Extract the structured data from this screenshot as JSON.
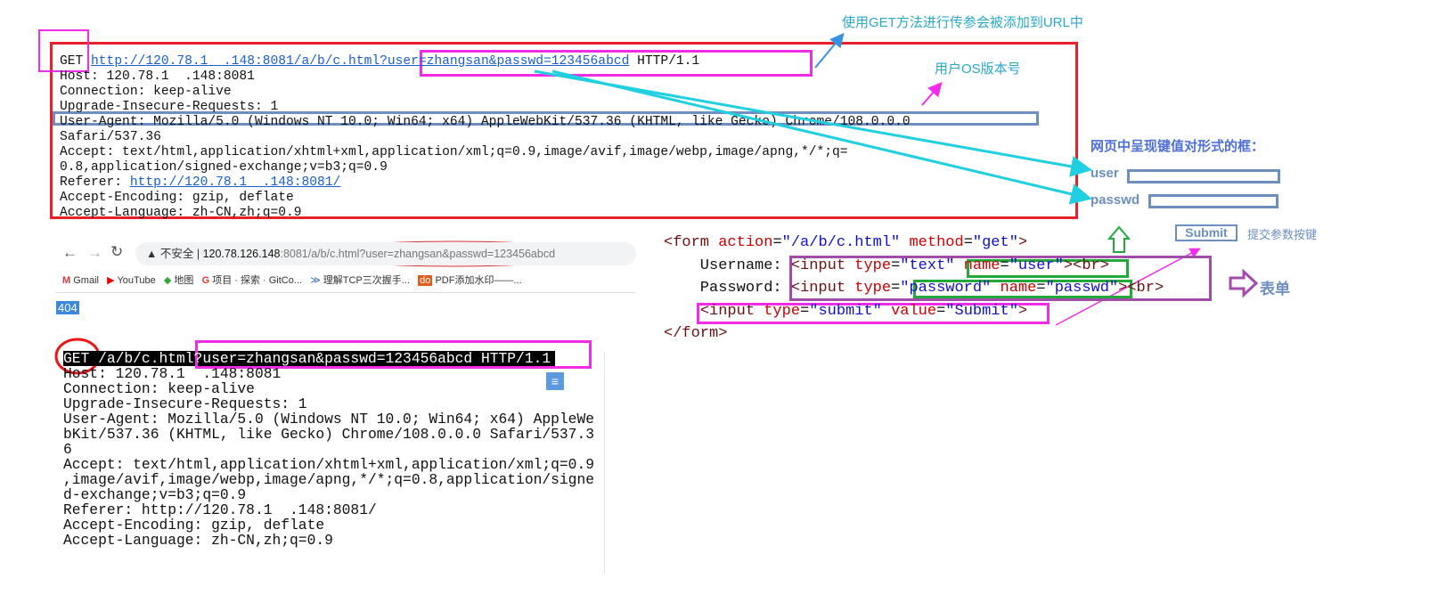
{
  "top_request": {
    "method": "GET",
    "url": "http://120.78.1  .148:8081/a/b/c.html",
    "query": "?user=zhangsan&passwd=123456abcd",
    "protocol": " HTTP/1.1",
    "lines": [
      "Host: 120.78.1  .148:8081",
      "Connection: keep-alive",
      "Upgrade-Insecure-Requests: 1",
      "User-Agent: Mozilla/5.0 (Windows NT 10.0; Win64; x64) AppleWebKit/537.36 (KHTML, like Gecko) Chrome/108.0.0.0",
      "Safari/537.36",
      "Accept: text/html,application/xhtml+xml,application/xml;q=0.9,image/avif,image/webp,image/apng,*/*;q=",
      "0.8,application/signed-exchange;v=b3;q=0.9"
    ],
    "referer_label": "Referer: ",
    "referer_url": "http://120.78.1  .148:8081/",
    "tail_lines": [
      "Accept-Encoding: gzip, deflate",
      "Accept-Language: zh-CN,zh;q=0.9"
    ]
  },
  "annotations": {
    "get_url": "使用GET方法进行传参会被添加到URL中",
    "os_version": "用户OS版本号",
    "kv_title": "网页中呈现键值对形式的框：",
    "user_label": "user",
    "passwd_label": "passwd",
    "submit_label": "Submit",
    "submit_note": "提交参数按键",
    "form_label": "表单"
  },
  "browser": {
    "insecure": "不安全",
    "host": "120.78.126.148",
    "port": ":8081",
    "path": "/a/b/c.html?user=zhangsan&passwd=123456abcd",
    "bookmarks": [
      "Gmail",
      "YouTube",
      "地图",
      "项目 · 探索 · GitCo...",
      "理解TCP三次握手...",
      "PDF添加水印——..."
    ],
    "page_text": "404"
  },
  "bottom_request": {
    "first_line": "GET /a/b/c.html?user=zhangsan&passwd=123456abcd HTTP/1.1",
    "lines": [
      "Host: 120.78.1  .148:8081",
      "Connection: keep-alive",
      "Upgrade-Insecure-Requests: 1",
      "User-Agent: Mozilla/5.0 (Windows NT 10.0; Win64; x64) AppleWe",
      "bKit/537.36 (KHTML, like Gecko) Chrome/108.0.0.0 Safari/537.3",
      "6",
      "Accept: text/html,application/xhtml+xml,application/xml;q=0.9",
      ",image/avif,image/webp,image/apng,*/*;q=0.8,application/signe",
      "d-exchange;v=b3;q=0.9",
      "Referer: http://120.78.1  .148:8081/",
      "Accept-Encoding: gzip, deflate",
      "Accept-Language: zh-CN,zh;q=0.9"
    ]
  },
  "form_code": {
    "l1": [
      "<form ",
      "action",
      "=",
      "\"/a/b/c.html\"",
      " ",
      "method",
      "=",
      "\"get\"",
      ">"
    ],
    "l2": [
      "    Username: ",
      "<input ",
      "type",
      "=",
      "\"text\"",
      " ",
      "name",
      "=",
      "\"user\"",
      "><br>"
    ],
    "l3": [
      "    Password: ",
      "<input ",
      "type",
      "=",
      "\"password\"",
      " ",
      "name",
      "=",
      "\"passwd\"",
      "><br>"
    ],
    "l4": [
      "    ",
      "<input ",
      "type",
      "=",
      "\"submit\"",
      " ",
      "value",
      "=",
      "\"Submit\"",
      ">"
    ],
    "l5": "</form>"
  },
  "colors": {
    "red_box": "#e8202a",
    "magenta_box": "#f02ce8",
    "steel_box": "#6d8fc0",
    "green_box": "#22a83a",
    "purple_box": "#a04ca8",
    "cyan_arrow": "#20d0e0"
  }
}
